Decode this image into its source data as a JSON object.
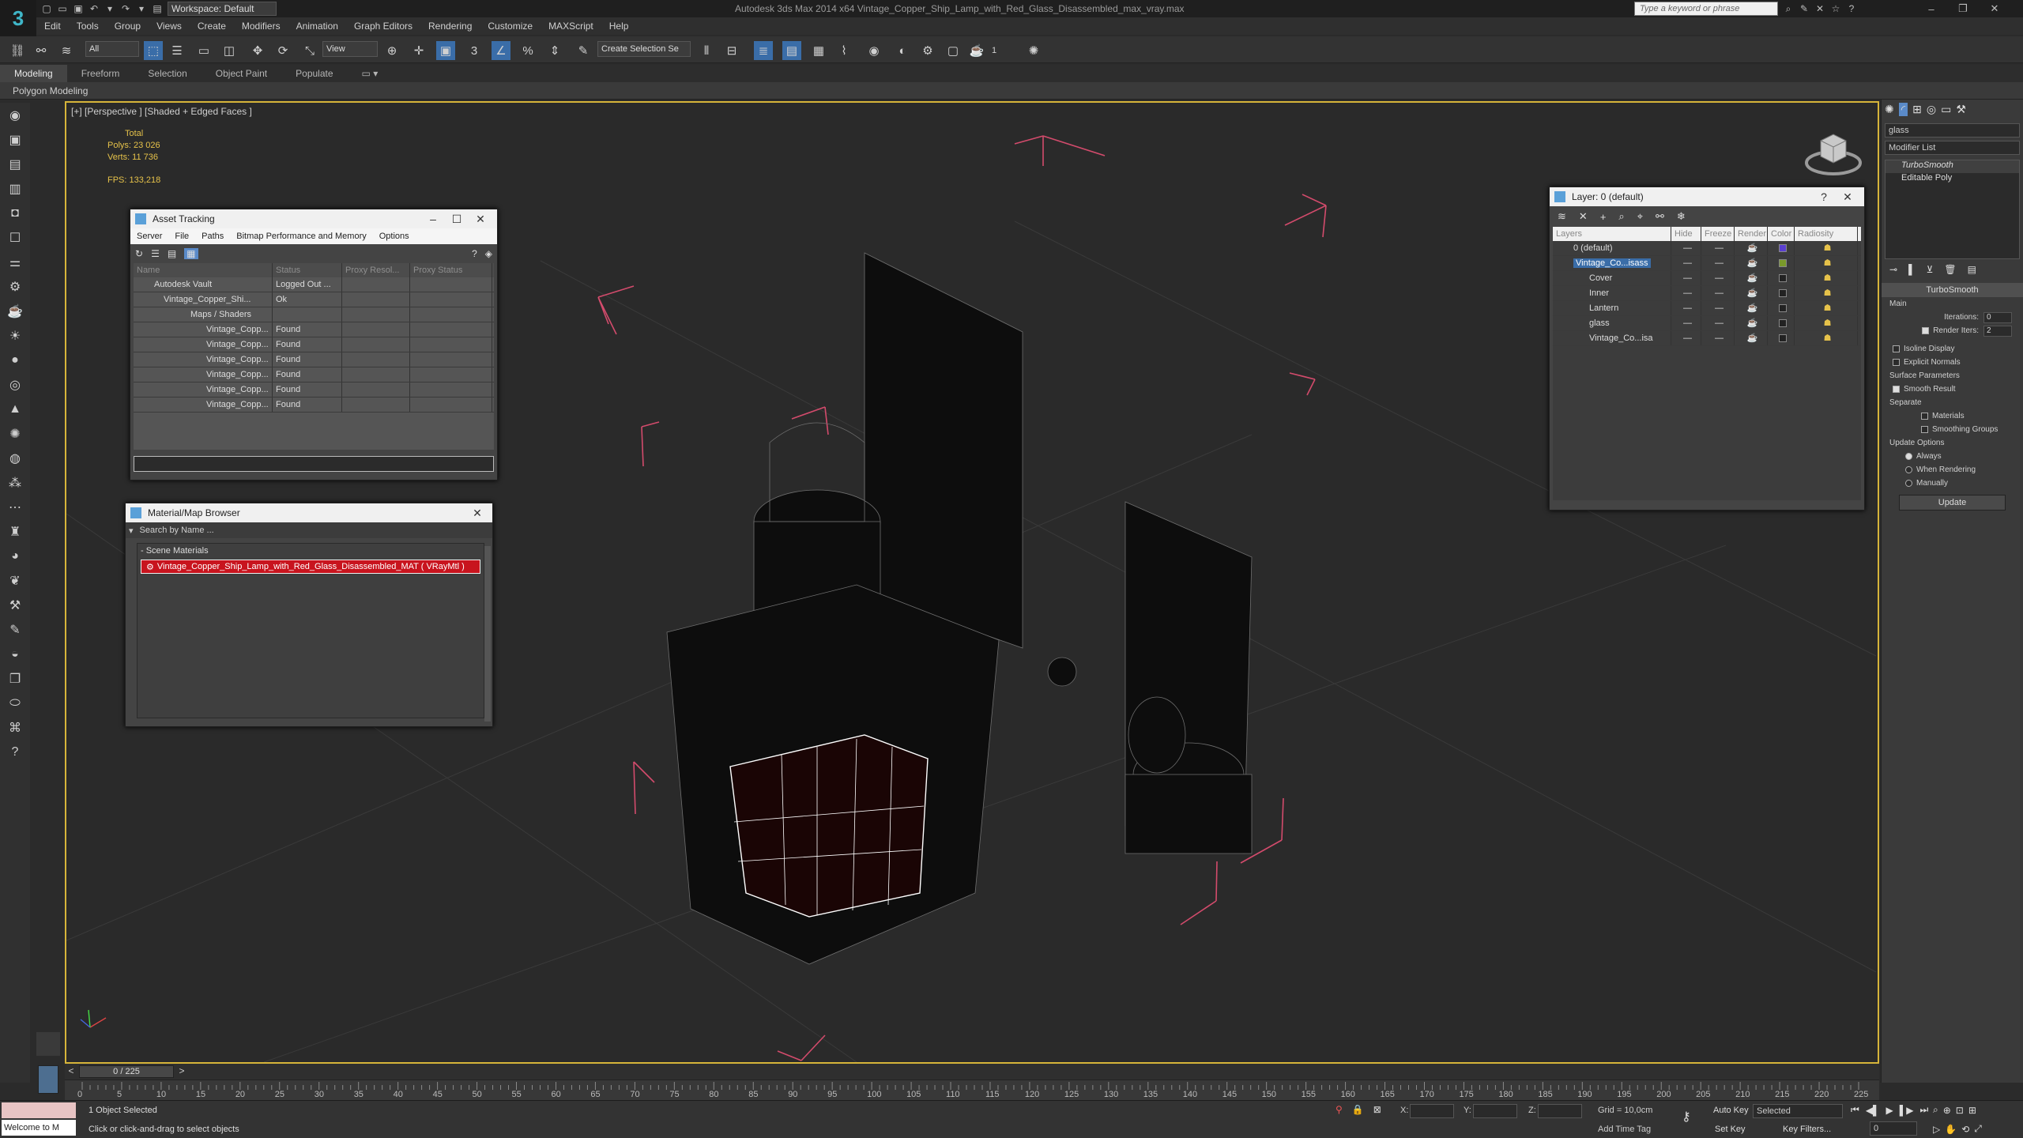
{
  "title_bar": {
    "workspace": "Workspace: Default",
    "window_title": "Autodesk 3ds Max  2014 x64      Vintage_Copper_Ship_Lamp_with_Red_Glass_Disassembled_max_vray.max",
    "search_placeholder": "Type a keyword or phrase"
  },
  "menu": [
    "Edit",
    "Tools",
    "Group",
    "Views",
    "Create",
    "Modifiers",
    "Animation",
    "Graph Editors",
    "Rendering",
    "Customize",
    "MAXScript",
    "Help"
  ],
  "toolbar": {
    "selection_filter": "All",
    "reference_coord": "View",
    "named_selection": "Create Selection Se",
    "snap_value": "3"
  },
  "ribbon": {
    "tabs": [
      "Modeling",
      "Freeform",
      "Selection",
      "Object Paint",
      "Populate"
    ],
    "sub_label": "Polygon Modeling"
  },
  "viewport": {
    "label": "[+] [Perspective ] [Shaded + Edged Faces ]",
    "stats": {
      "total_label": "Total",
      "polys": "Polys:  23 026",
      "verts": "Verts:  11 736",
      "fps": "FPS:    133,218"
    }
  },
  "asset_tracking": {
    "title": "Asset Tracking",
    "menu": [
      "Server",
      "File",
      "Paths",
      "Bitmap Performance and Memory",
      "Options"
    ],
    "columns": [
      "Name",
      "Status",
      "Proxy Resol...",
      "Proxy Status"
    ],
    "rows": [
      {
        "name": "Autodesk Vault",
        "status": "Logged Out ..."
      },
      {
        "name": "Vintage_Copper_Shi...",
        "status": "Ok"
      },
      {
        "name": "Maps / Shaders",
        "status": ""
      },
      {
        "name": "Vintage_Copp...",
        "status": "Found"
      },
      {
        "name": "Vintage_Copp...",
        "status": "Found"
      },
      {
        "name": "Vintage_Copp...",
        "status": "Found"
      },
      {
        "name": "Vintage_Copp...",
        "status": "Found"
      },
      {
        "name": "Vintage_Copp...",
        "status": "Found"
      },
      {
        "name": "Vintage_Copp...",
        "status": "Found"
      }
    ]
  },
  "material_browser": {
    "title": "Material/Map Browser",
    "search_placeholder": "Search by Name ...",
    "group": "- Scene Materials",
    "material": "Vintage_Copper_Ship_Lamp_with_Red_Glass_Disassembled_MAT ( VRayMtl )"
  },
  "layer_manager": {
    "title": "Layer: 0 (default)",
    "columns": [
      "Layers",
      "Hide",
      "Freeze",
      "Render",
      "Color",
      "Radiosity"
    ],
    "rows": [
      {
        "name": "0 (default)",
        "color": "#5a3fd0",
        "selected": false,
        "indent": 0
      },
      {
        "name": "Vintage_Co...isass",
        "color": "#7a9a2a",
        "selected": true,
        "indent": 0
      },
      {
        "name": "Cover",
        "color": "#222222",
        "selected": false,
        "indent": 1
      },
      {
        "name": "Inner",
        "color": "#222222",
        "selected": false,
        "indent": 1
      },
      {
        "name": "Lantern",
        "color": "#222222",
        "selected": false,
        "indent": 1
      },
      {
        "name": "glass",
        "color": "#222222",
        "selected": false,
        "indent": 1
      },
      {
        "name": "Vintage_Co...isa",
        "color": "#222222",
        "selected": false,
        "indent": 1
      }
    ]
  },
  "command_panel": {
    "object_name": "glass",
    "modifier_list": "Modifier List",
    "stack": [
      "TurboSmooth",
      "Editable Poly"
    ],
    "turbosmooth": {
      "title": "TurboSmooth",
      "main": "Main",
      "iterations_label": "Iterations:",
      "iterations": "0",
      "render_iters_label": "Render Iters:",
      "render_iters": "2",
      "isoline": "Isoline Display",
      "explicit": "Explicit Normals",
      "surface_params": "Surface Parameters",
      "smooth_result": "Smooth Result",
      "separate": "Separate",
      "materials": "Materials",
      "smoothing_groups": "Smoothing Groups",
      "update_options": "Update Options",
      "always": "Always",
      "when_rendering": "When Rendering",
      "manually": "Manually",
      "update": "Update"
    }
  },
  "timeline": {
    "frame": "0 / 225",
    "ticks": [
      "0",
      "5",
      "10",
      "15",
      "20",
      "25",
      "30",
      "35",
      "40",
      "45",
      "50",
      "55",
      "60",
      "65",
      "70",
      "75",
      "80",
      "85",
      "90",
      "95",
      "100",
      "105",
      "110",
      "115",
      "120",
      "125",
      "130",
      "135",
      "140",
      "145",
      "150",
      "155",
      "160",
      "165",
      "170",
      "175",
      "180",
      "185",
      "190",
      "195",
      "200",
      "205",
      "210",
      "215",
      "220",
      "225"
    ]
  },
  "status": {
    "maxscript": "Welcome to M",
    "selected": "1 Object Selected",
    "prompt": "Click or click-and-drag to select objects",
    "x_label": "X:",
    "y_label": "Y:",
    "z_label": "Z:",
    "grid": "Grid = 10,0cm",
    "add_time_tag": "Add Time Tag",
    "auto_key": "Auto Key",
    "set_key": "Set Key",
    "key_mode": "Selected",
    "key_filters": "Key Filters...",
    "current_frame": "0"
  }
}
